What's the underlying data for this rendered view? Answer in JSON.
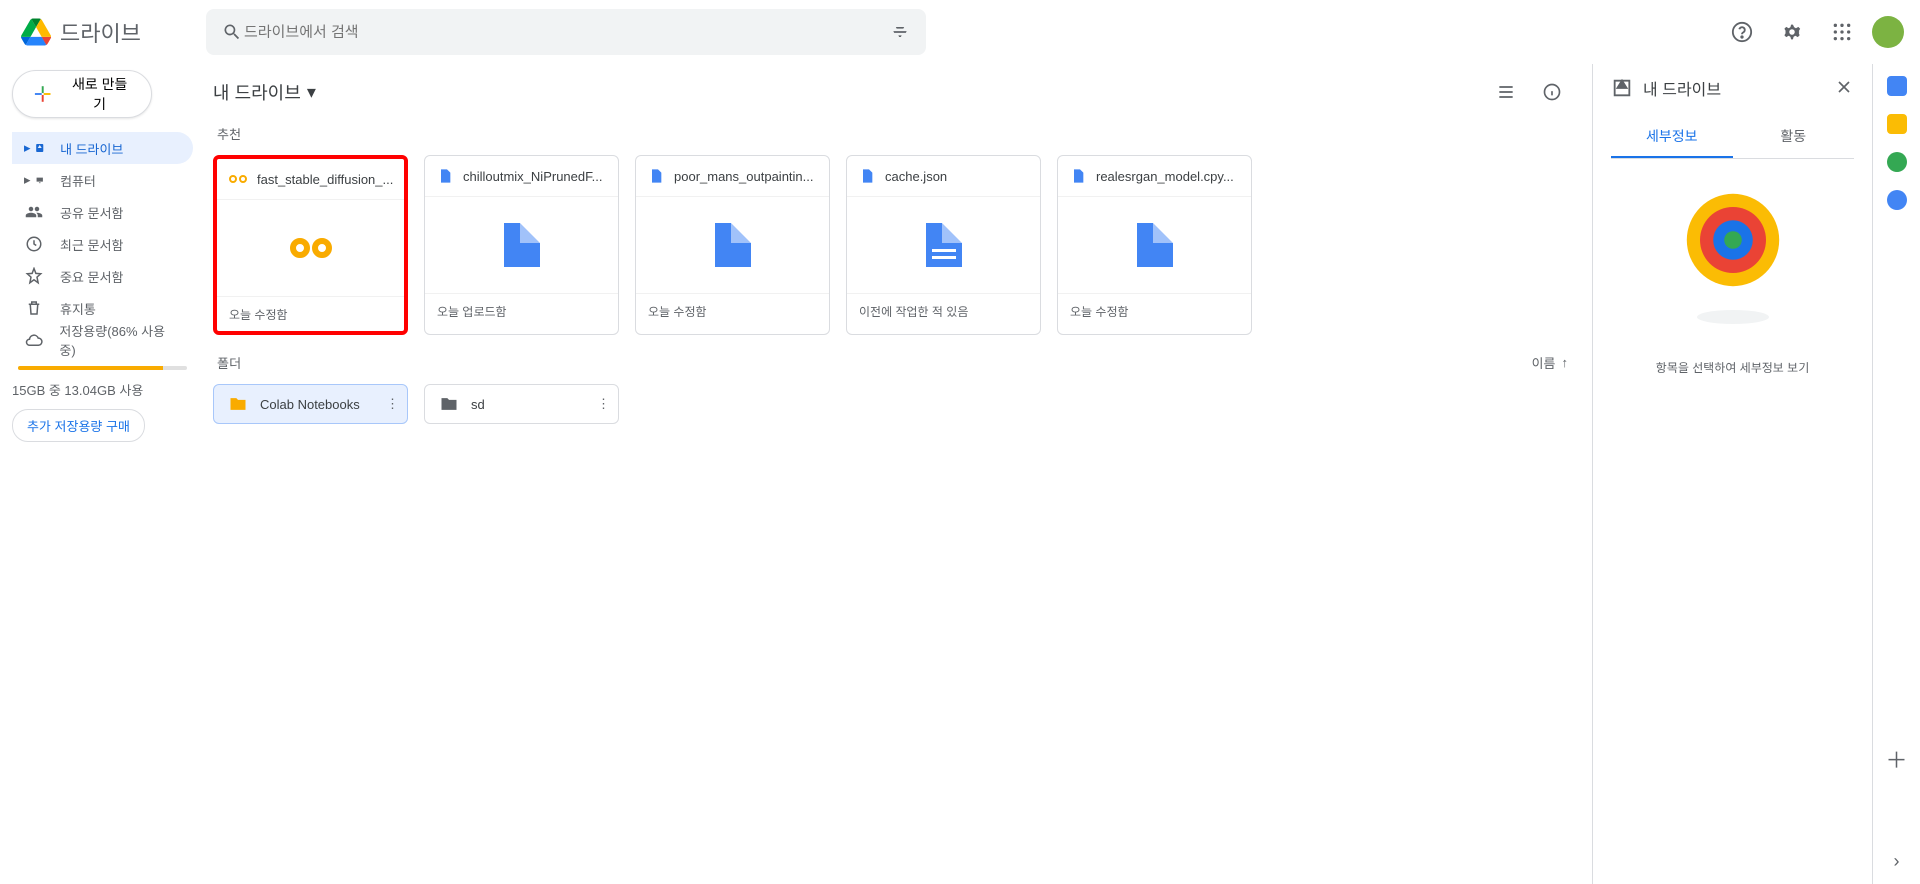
{
  "app_name": "드라이브",
  "search_placeholder": "드라이브에서 검색",
  "new_button": "새로 만들기",
  "nav": [
    {
      "label": "내 드라이브"
    },
    {
      "label": "컴퓨터"
    },
    {
      "label": "공유 문서함"
    },
    {
      "label": "최근 문서함"
    },
    {
      "label": "중요 문서함"
    },
    {
      "label": "휴지통"
    },
    {
      "label": "저장용량(86% 사용 중)"
    }
  ],
  "storage": {
    "text": "15GB 중 13.04GB 사용",
    "buy": "추가 저장용량 구매"
  },
  "breadcrumb": "내 드라이브",
  "section_suggested": "추천",
  "cards": [
    {
      "name": "fast_stable_diffusion_...",
      "status": "오늘 수정함",
      "icon": "colab"
    },
    {
      "name": "chilloutmix_NiPrunedF...",
      "status": "오늘 업로드함",
      "icon": "file"
    },
    {
      "name": "poor_mans_outpaintin...",
      "status": "오늘 수정함",
      "icon": "file"
    },
    {
      "name": "cache.json",
      "status": "이전에 작업한 적 있음",
      "icon": "file"
    },
    {
      "name": "realesrgan_model.cpy...",
      "status": "오늘 수정함",
      "icon": "file"
    }
  ],
  "section_folders": "폴더",
  "sort_label": "이름",
  "folders": [
    {
      "name": "Colab Notebooks"
    },
    {
      "name": "sd"
    }
  ],
  "details": {
    "title": "내 드라이브",
    "tab_details": "세부정보",
    "tab_activity": "활동",
    "empty": "항목을 선택하여 세부정보 보기"
  }
}
